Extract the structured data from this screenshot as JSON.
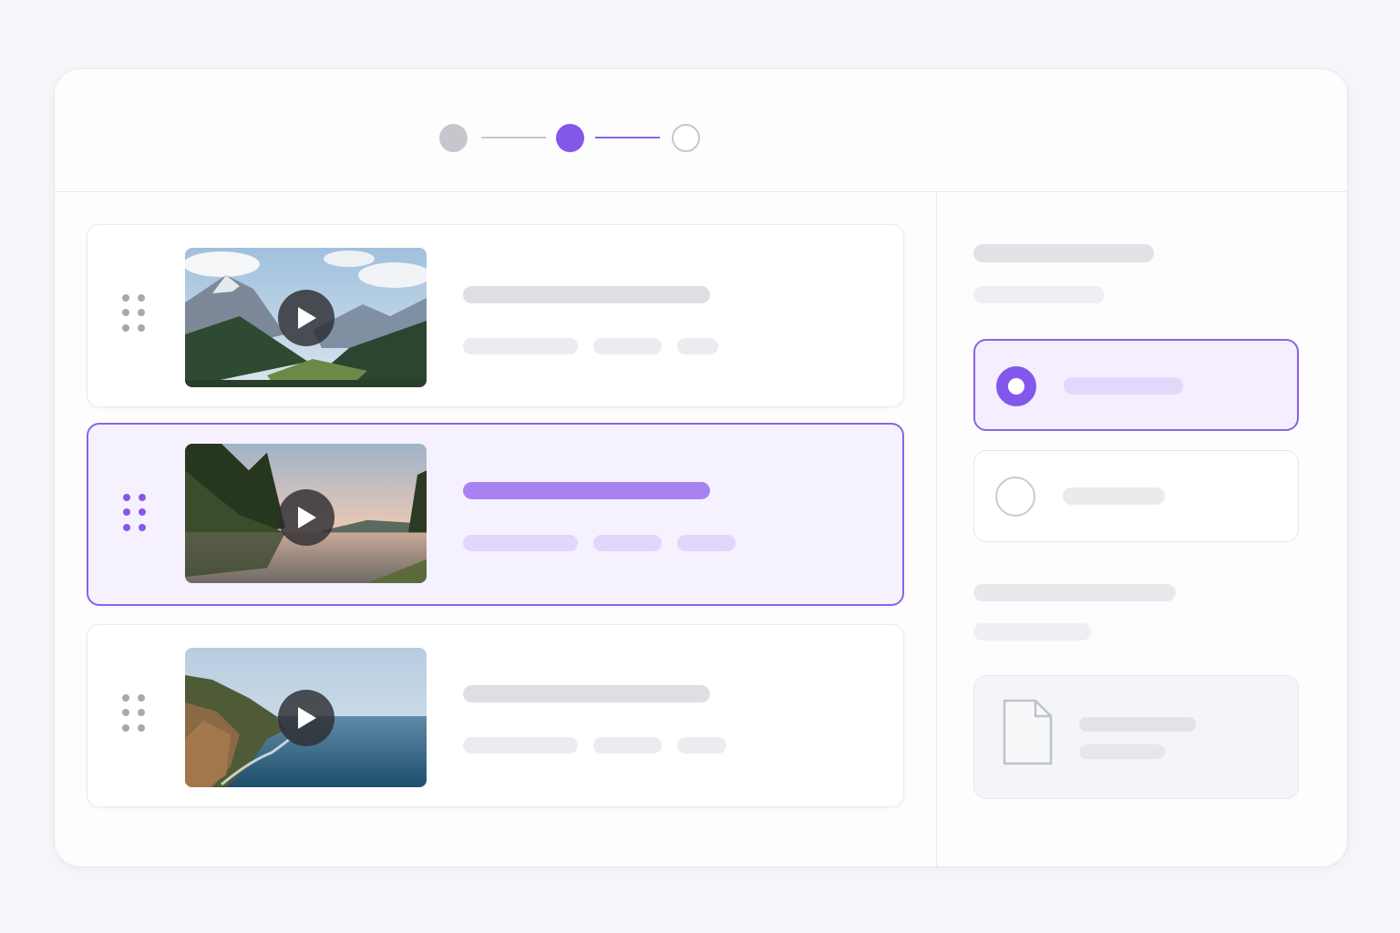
{
  "colors": {
    "accent": "#8257ea",
    "accent_light": "#f6f1fe",
    "placeholder_gray": "#dedfe3",
    "placeholder_light": "#ebecef",
    "step_done": "#c5c7cd"
  },
  "stepper": {
    "steps": [
      {
        "state": "completed"
      },
      {
        "state": "current"
      },
      {
        "state": "upcoming"
      }
    ]
  },
  "videos": [
    {
      "scene": "mountain-valley",
      "selected": false,
      "icon": "play-icon"
    },
    {
      "scene": "forest-lake-sunset",
      "selected": true,
      "icon": "play-icon"
    },
    {
      "scene": "coastal-cliffs",
      "selected": false,
      "icon": "play-icon"
    }
  ],
  "options": [
    {
      "selected": true
    },
    {
      "selected": false
    }
  ],
  "attachment": {
    "icon": "file-icon"
  }
}
